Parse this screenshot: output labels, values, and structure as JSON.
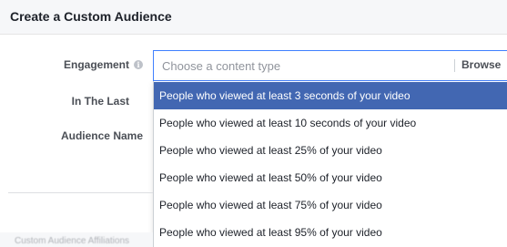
{
  "dialog": {
    "title": "Create a Custom Audience"
  },
  "form": {
    "engagement_label": "Engagement",
    "in_the_last_label": "In The Last",
    "audience_name_label": "Audience Name",
    "content_type_placeholder": "Choose a content type",
    "browse_label": "Browse"
  },
  "dropdown": {
    "options": [
      "People who viewed at least 3 seconds of your video",
      "People who viewed at least 10 seconds of your video",
      "People who viewed at least 25% of your video",
      "People who viewed at least 50% of your video",
      "People who viewed at least 75% of your video",
      "People who viewed at least 95% of your video"
    ],
    "selected_index": 0
  },
  "footer": {
    "partial_text": "Custom Audience Affiliations"
  },
  "colors": {
    "selected_bg": "#4267b2",
    "focus_border": "#4080ff"
  },
  "icons": {
    "engagement_info": "info-icon"
  }
}
